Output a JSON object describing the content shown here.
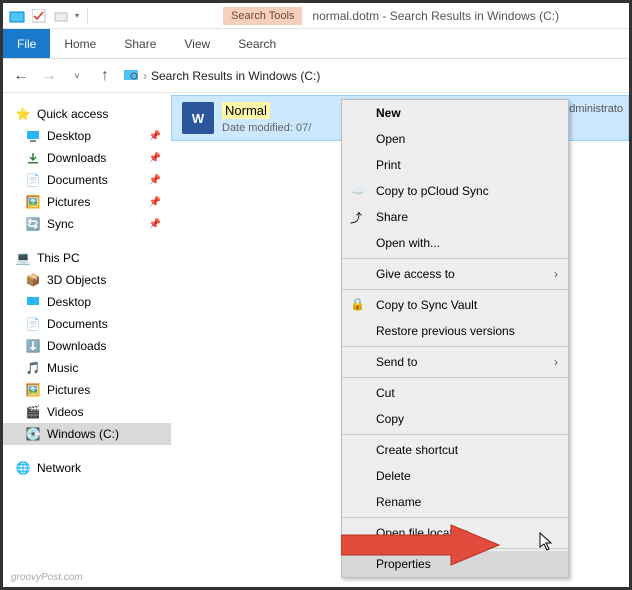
{
  "qat": {
    "title": "normal.dotm - Search Results in Windows (C:)",
    "search_tools": "Search Tools"
  },
  "ribbon": {
    "file": "File",
    "home": "Home",
    "share": "Share",
    "view": "View",
    "search": "Search"
  },
  "breadcrumb": {
    "label": "Search Results in Windows (C:)"
  },
  "sidebar": {
    "quick_access": "Quick access",
    "qa_items": [
      {
        "label": "Desktop"
      },
      {
        "label": "Downloads"
      },
      {
        "label": "Documents"
      },
      {
        "label": "Pictures"
      },
      {
        "label": "Sync"
      }
    ],
    "this_pc": "This PC",
    "pc_items": [
      {
        "label": "3D Objects"
      },
      {
        "label": "Desktop"
      },
      {
        "label": "Documents"
      },
      {
        "label": "Downloads"
      },
      {
        "label": "Music"
      },
      {
        "label": "Pictures"
      },
      {
        "label": "Videos"
      },
      {
        "label": "Windows (C:)"
      }
    ],
    "network": "Network"
  },
  "result": {
    "name": "Normal",
    "date_label": "Date modified: 07/",
    "path": "C:\\Users\\Administrato"
  },
  "context_menu": {
    "new": "New",
    "open": "Open",
    "print": "Print",
    "copy_pcloud": "Copy to pCloud Sync",
    "share": "Share",
    "open_with": "Open with...",
    "give_access": "Give access to",
    "copy_sync_vault": "Copy to Sync Vault",
    "restore": "Restore previous versions",
    "send_to": "Send to",
    "cut": "Cut",
    "copy": "Copy",
    "create_shortcut": "Create shortcut",
    "delete": "Delete",
    "rename": "Rename",
    "open_location": "Open file location",
    "properties": "Properties"
  },
  "watermark": "groovyPost.com"
}
